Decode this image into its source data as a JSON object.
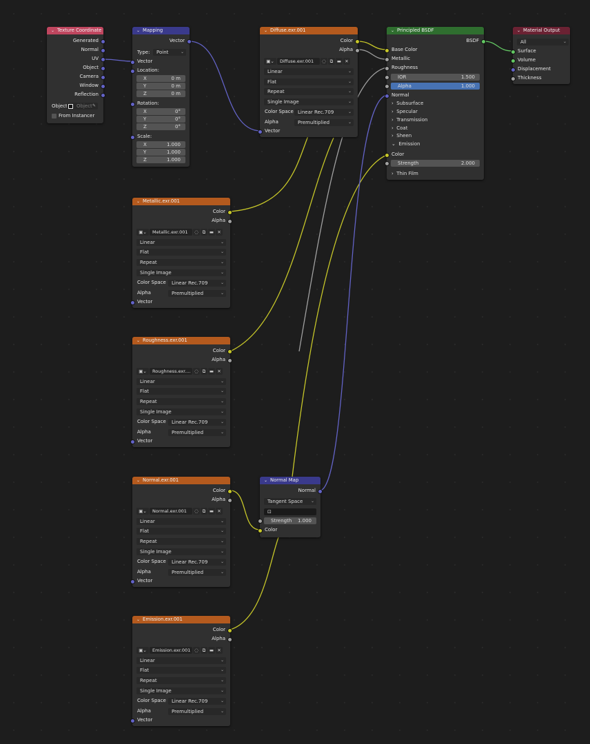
{
  "texcoord": {
    "title": "Texture Coordinate",
    "outputs": [
      "Generated",
      "Normal",
      "UV",
      "Object",
      "Camera",
      "Window",
      "Reflection"
    ],
    "object_label": "Object:",
    "object_placeholder": "Object",
    "from_instancer": "From Instancer"
  },
  "mapping": {
    "title": "Mapping",
    "out": "Vector",
    "type_label": "Type:",
    "type_value": "Point",
    "in_vector": "Vector",
    "location_label": "Location:",
    "location": [
      {
        "k": "X",
        "v": "0 m"
      },
      {
        "k": "Y",
        "v": "0 m"
      },
      {
        "k": "Z",
        "v": "0 m"
      }
    ],
    "rotation_label": "Rotation:",
    "rotation": [
      {
        "k": "X",
        "v": "0°"
      },
      {
        "k": "Y",
        "v": "0°"
      },
      {
        "k": "Z",
        "v": "0°"
      }
    ],
    "scale_label": "Scale:",
    "scale": [
      {
        "k": "X",
        "v": "1.000"
      },
      {
        "k": "Y",
        "v": "1.000"
      },
      {
        "k": "Z",
        "v": "1.000"
      }
    ]
  },
  "diffuse": {
    "title": "Diffuse.exr.001",
    "file": "Diffuse.exr.001",
    "out_color": "Color",
    "out_alpha": "Alpha",
    "interp": "Linear",
    "proj": "Flat",
    "ext": "Repeat",
    "source": "Single Image",
    "cs_label": "Color Space",
    "cs": "Linear Rec.709",
    "alpha_label": "Alpha",
    "alpha": "Premultiplied",
    "in_vector": "Vector"
  },
  "metallic": {
    "title": "Metallic.exr.001",
    "file": "Metallic.exr.001",
    "out_color": "Color",
    "out_alpha": "Alpha",
    "interp": "Linear",
    "proj": "Flat",
    "ext": "Repeat",
    "source": "Single Image",
    "cs_label": "Color Space",
    "cs": "Linear Rec.709",
    "alpha_label": "Alpha",
    "alpha": "Premultiplied",
    "in_vector": "Vector"
  },
  "roughness": {
    "title": "Roughness.exr.001",
    "file": "Roughness.exr....",
    "out_color": "Color",
    "out_alpha": "Alpha",
    "interp": "Linear",
    "proj": "Flat",
    "ext": "Repeat",
    "source": "Single Image",
    "cs_label": "Color Space",
    "cs": "Linear Rec.709",
    "alpha_label": "Alpha",
    "alpha": "Premultiplied",
    "in_vector": "Vector"
  },
  "normaltex": {
    "title": "Normal.exr.001",
    "file": "Normal.exr.001",
    "out_color": "Color",
    "out_alpha": "Alpha",
    "interp": "Linear",
    "proj": "Flat",
    "ext": "Repeat",
    "source": "Single Image",
    "cs_label": "Color Space",
    "cs": "Linear Rec.709",
    "alpha_label": "Alpha",
    "alpha": "Premultiplied",
    "in_vector": "Vector"
  },
  "emission": {
    "title": "Emission.exr.001",
    "file": "Emission.exr.001",
    "out_color": "Color",
    "out_alpha": "Alpha",
    "interp": "Linear",
    "proj": "Flat",
    "ext": "Repeat",
    "source": "Single Image",
    "cs_label": "Color Space",
    "cs": "Linear Rec.709",
    "alpha_label": "Alpha",
    "alpha": "Premultiplied",
    "in_vector": "Vector"
  },
  "normalmap": {
    "title": "Normal Map",
    "out": "Normal",
    "space": "Tangent Space",
    "strength_label": "Strength",
    "strength": "1.000",
    "in_color": "Color"
  },
  "bsdf": {
    "title": "Principled BSDF",
    "out": "BSDF",
    "base_color": "Base Color",
    "metallic": "Metallic",
    "roughness": "Roughness",
    "ior_label": "IOR",
    "ior": "1.500",
    "alpha_label": "Alpha",
    "alpha": "1.000",
    "normal": "Normal",
    "panels": [
      "Subsurface",
      "Specular",
      "Transmission",
      "Coat",
      "Sheen",
      "Emission"
    ],
    "emission_color": "Color",
    "strength_label": "Strength",
    "strength": "2.000",
    "thin_film": "Thin Film"
  },
  "output": {
    "title": "Material Output",
    "target": "All",
    "inputs": [
      "Surface",
      "Volume",
      "Displacement",
      "Thickness"
    ]
  },
  "colors": {
    "yellow_wire": "#c7c729",
    "gray_wire": "#a1a1a1",
    "violet_wire": "#6363c7",
    "green_wire": "#63c763"
  }
}
